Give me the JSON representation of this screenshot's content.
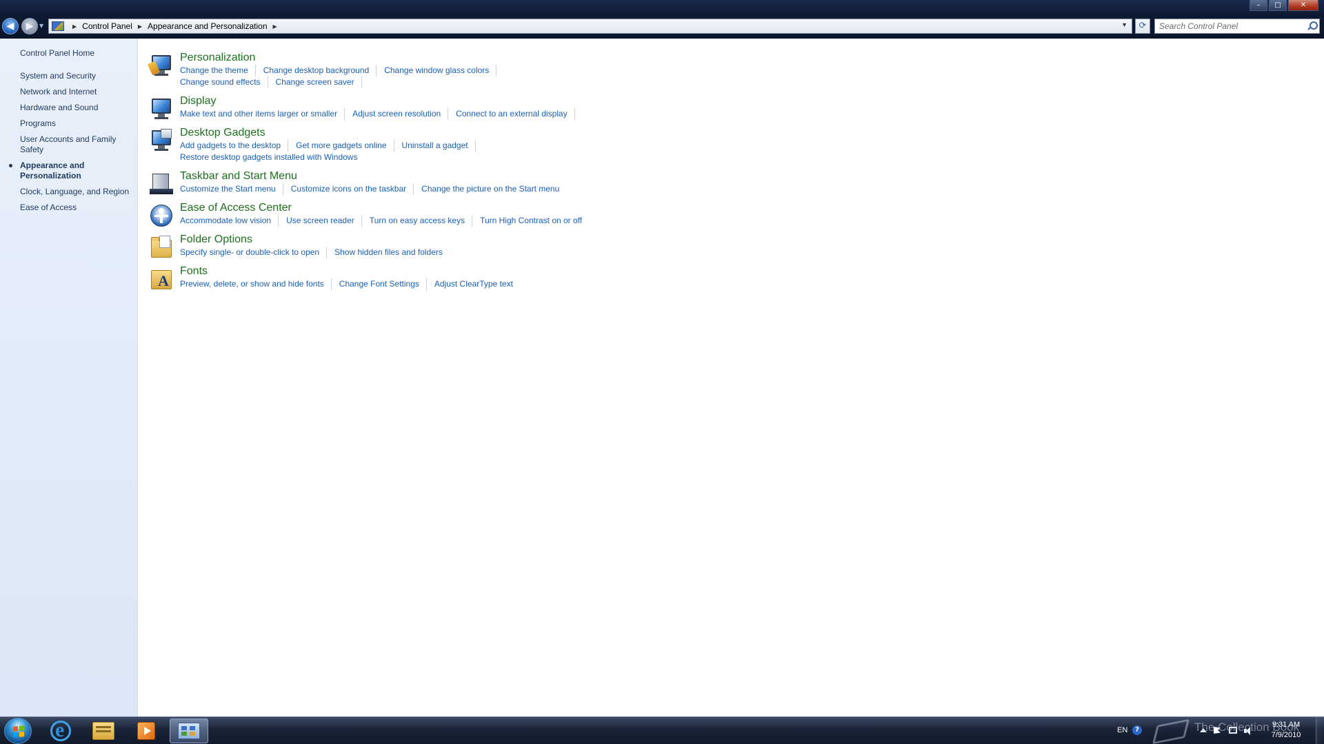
{
  "window": {
    "minimize_glyph": "–",
    "maximize_glyph": "□",
    "close_glyph": "✕"
  },
  "navigation": {
    "back_glyph": "◀",
    "forward_glyph": "▶"
  },
  "address_bar": {
    "breadcrumbs": [
      "Control Panel",
      "Appearance and Personalization"
    ],
    "separator_glyph": "▶",
    "dropdown_glyph": "▼"
  },
  "refresh": {
    "glyph": "⟳"
  },
  "search": {
    "placeholder": "Search Control Panel"
  },
  "left_pane": {
    "home": "Control Panel Home",
    "items": [
      {
        "label": "System and Security",
        "active": false
      },
      {
        "label": "Network and Internet",
        "active": false
      },
      {
        "label": "Hardware and Sound",
        "active": false
      },
      {
        "label": "Programs",
        "active": false
      },
      {
        "label": "User Accounts and Family Safety",
        "active": false
      },
      {
        "label": "Appearance and Personalization",
        "active": true
      },
      {
        "label": "Clock, Language, and Region",
        "active": false
      },
      {
        "label": "Ease of Access",
        "active": false
      }
    ]
  },
  "categories": [
    {
      "title": "Personalization",
      "icon": "personalization-icon",
      "links": [
        "Change the theme",
        "Change desktop background",
        "Change window glass colors",
        "Change sound effects",
        "Change screen saver"
      ]
    },
    {
      "title": "Display",
      "icon": "display-icon",
      "links": [
        "Make text and other items larger or smaller",
        "Adjust screen resolution",
        "Connect to an external display"
      ]
    },
    {
      "title": "Desktop Gadgets",
      "icon": "desktop-gadgets-icon",
      "links": [
        "Add gadgets to the desktop",
        "Get more gadgets online",
        "Uninstall a gadget",
        "Restore desktop gadgets installed with Windows"
      ]
    },
    {
      "title": "Taskbar and Start Menu",
      "icon": "taskbar-start-menu-icon",
      "links": [
        "Customize the Start menu",
        "Customize icons on the taskbar",
        "Change the picture on the Start menu"
      ]
    },
    {
      "title": "Ease of Access Center",
      "icon": "ease-of-access-icon",
      "links": [
        "Accommodate low vision",
        "Use screen reader",
        "Turn on easy access keys",
        "Turn High Contrast on or off"
      ]
    },
    {
      "title": "Folder Options",
      "icon": "folder-options-icon",
      "links": [
        "Specify single- or double-click to open",
        "Show hidden files and folders"
      ]
    },
    {
      "title": "Fonts",
      "icon": "fonts-icon",
      "links": [
        "Preview, delete, or show and hide fonts",
        "Change Font Settings",
        "Adjust ClearType text"
      ]
    }
  ],
  "taskbar": {
    "apps": [
      "start-orb",
      "internet-explorer-icon",
      "windows-explorer-icon",
      "media-player-icon",
      "control-panel-icon"
    ],
    "tray": {
      "language": "EN",
      "help_glyph": "?",
      "time": "9:31 AM",
      "date": "7/9/2010"
    }
  },
  "watermark": {
    "text": "The Collection Book"
  }
}
